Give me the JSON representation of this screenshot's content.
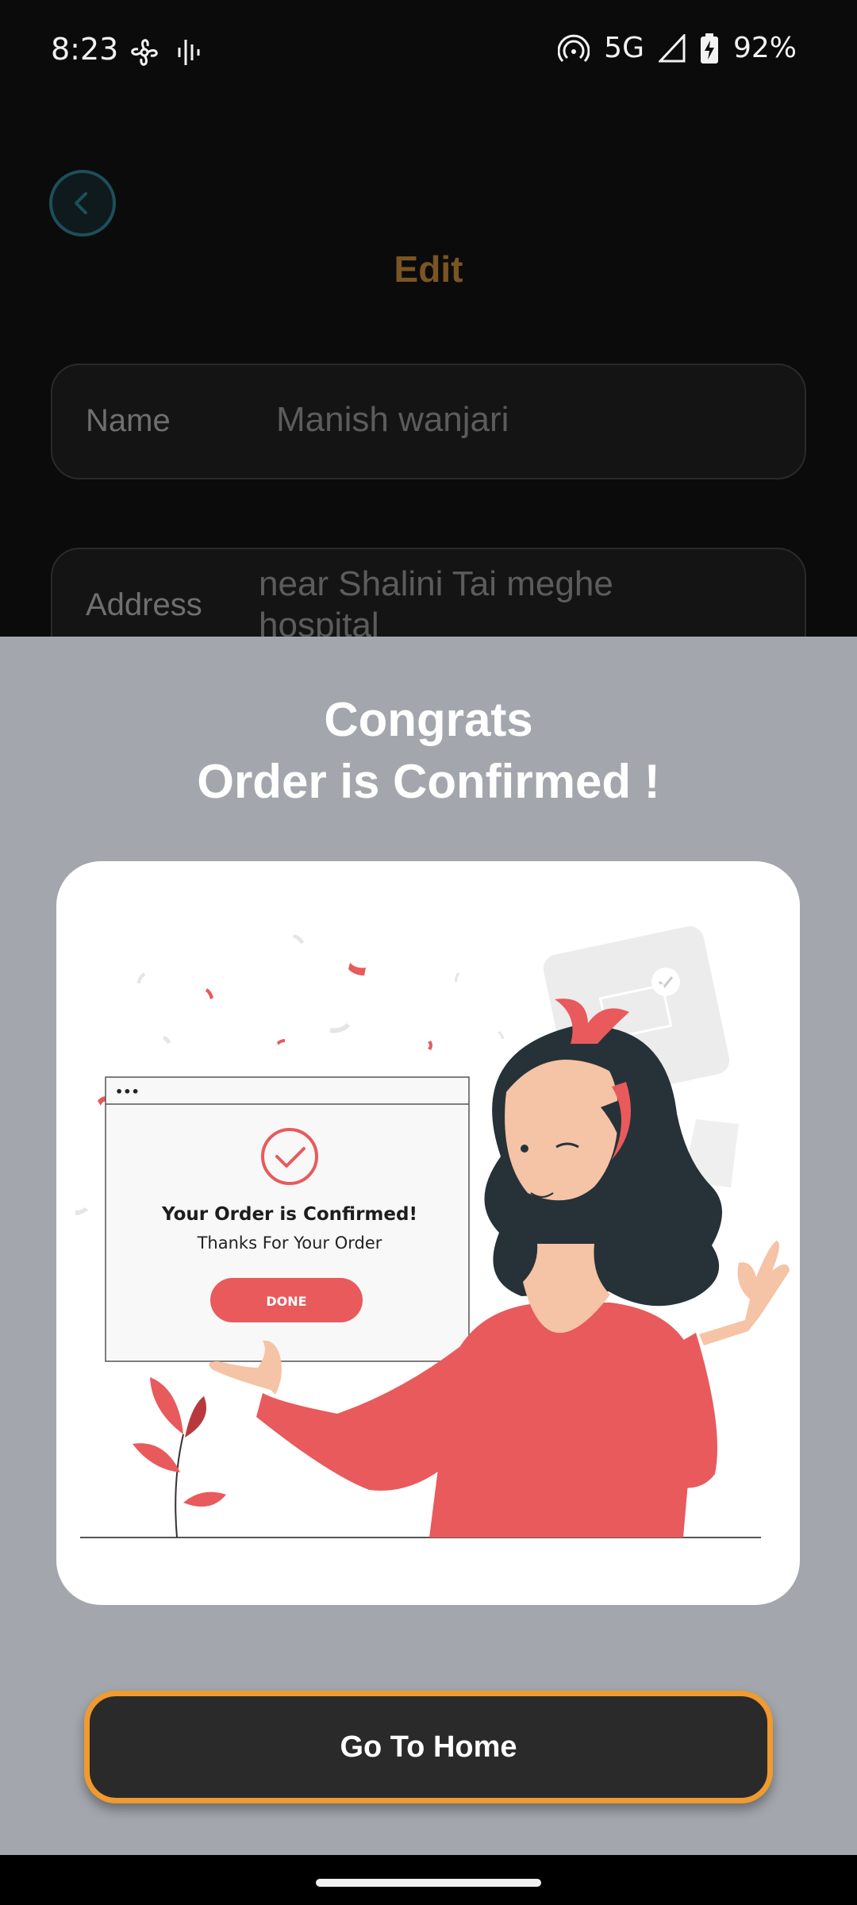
{
  "status_bar": {
    "time": "8:23",
    "network": "5G",
    "battery": "92%",
    "icons": [
      "fan-icon",
      "voice-wave-icon",
      "hotspot-icon",
      "signal-icon",
      "battery-charging-icon"
    ]
  },
  "edit_screen": {
    "title": "Edit",
    "back_icon": "chevron-left-icon",
    "name_label": "Name",
    "name_value": "Manish wanjari",
    "address_label": "Address",
    "address_value": "near Shalini Tai meghe hospital"
  },
  "dialog": {
    "title_line1": "Congrats",
    "title_line2": "Order is Confirmed !",
    "illustration": {
      "heading": "Your Order is Confirmed!",
      "subtext": "Thanks For Your Order",
      "button_label": "DONE",
      "window_dots": "•••",
      "accent_color": "#e85a5c"
    },
    "home_button_label": "Go To Home",
    "button_border_color": "#f09a2f"
  }
}
